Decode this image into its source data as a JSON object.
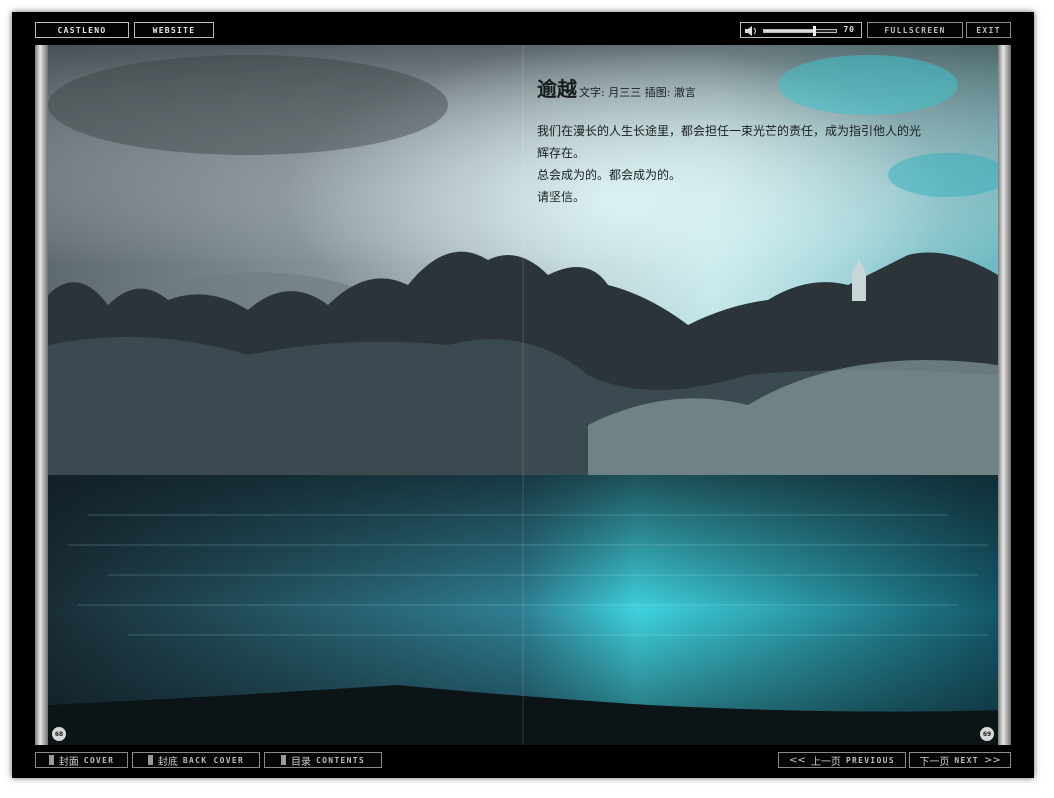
{
  "toolbar_top": {
    "castleno": "CASTLENO",
    "website": "WEBSITE",
    "volume_value": "70",
    "volume_level": 0.7,
    "fullscreen": "FULLSCREEN",
    "exit": "EXIT"
  },
  "article": {
    "title": "逾越",
    "credits": "文字: 月三三   插图: 澈言",
    "lines": [
      "我们在漫长的人生长途里，都会担任一束光芒的责任，成为指引他人的光",
      "辉存在。",
      "总会成为的。都会成为的。",
      "请坚信。"
    ]
  },
  "page_numbers": {
    "left": "68",
    "right": "69"
  },
  "toolbar_bottom": {
    "cover_cn": "封面",
    "cover_en": "COVER",
    "back_cn": "封底",
    "back_en": "BACK COVER",
    "contents_cn": "目录",
    "contents_en": "CONTENTS",
    "prev_cn": "上一页",
    "prev_en": "PREVIOUS",
    "next_cn": "下一页",
    "next_en": "NEXT",
    "prev_arrows": "<<",
    "next_arrows": ">>"
  },
  "colors": {
    "frame": "#000000",
    "water": "#1fb4c4",
    "sky": "#9fb3b8"
  }
}
